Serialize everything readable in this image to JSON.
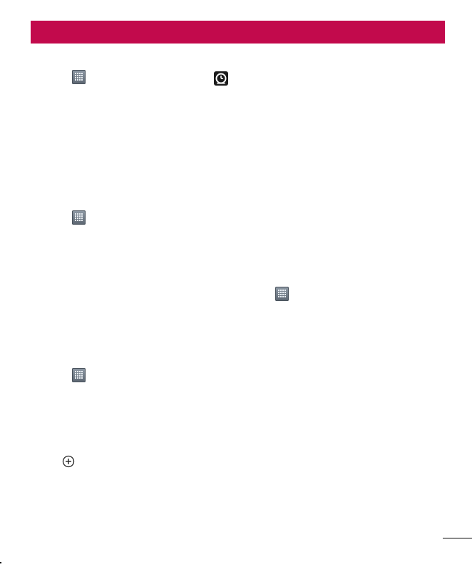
{
  "header": {
    "color": "#c20a4c",
    "title": ""
  },
  "icons": [
    {
      "name": "apps-icon",
      "glyph": "apps-grid"
    },
    {
      "name": "clock-icon",
      "glyph": "clock"
    },
    {
      "name": "apps-icon",
      "glyph": "apps-grid"
    },
    {
      "name": "apps-icon",
      "glyph": "apps-grid"
    },
    {
      "name": "apps-icon",
      "glyph": "apps-grid"
    },
    {
      "name": "add-icon",
      "glyph": "plus-in-circle"
    }
  ],
  "footer": {
    "page_number": ""
  }
}
